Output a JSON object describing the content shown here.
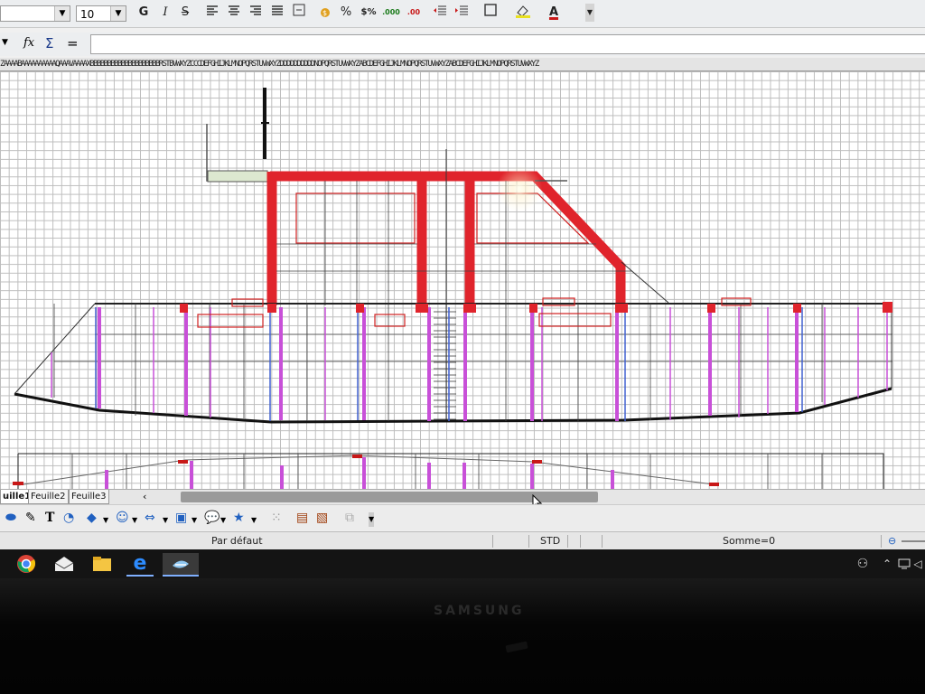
{
  "toolbar": {
    "font_size": "10",
    "bold": "G",
    "italic": "I",
    "strike": "S",
    "percent": "%",
    "currency": "$%",
    "decimal_add": ".000",
    "decimal_remove": ".00",
    "font_color_letter": "A"
  },
  "formula_bar": {
    "fx": "fx",
    "sum": "Σ",
    "equals": "=",
    "value": ""
  },
  "column_headers": "ZAAAABAAAAAAAAAAQAAAVAAAAXBBBBBBBBBBBBBBBBBBBBRSTBVWXYZCCCDEFGHIJKLMNOPQRSTUVWXYZDDDDDDDDDDNOPQRSTUVWXYZABCDEFGHIJKLMNOPQRSTUVWXYZABCDEFGHIJKLMNOPQRSTUVWXYZ",
  "sheet_tabs": [
    "uille1",
    "Feuille2",
    "Feuille3"
  ],
  "status_bar": {
    "page_style": "Par défaut",
    "selection_mode": "STD",
    "sum": "Somme=0"
  },
  "monitor_brand": "SAMSUNG",
  "colors": {
    "frame_red": "#e0242c",
    "stud_magenta": "#c850d8",
    "stud_blue": "#4060d0",
    "outline": "#1a1a1a"
  },
  "icons": {
    "taskbar": [
      "chrome-icon",
      "mail-icon",
      "file-explorer-icon",
      "edge-icon",
      "libreoffice-icon"
    ],
    "tray": [
      "people-icon",
      "chevron-up-icon",
      "network-icon",
      "volume-icon"
    ]
  }
}
